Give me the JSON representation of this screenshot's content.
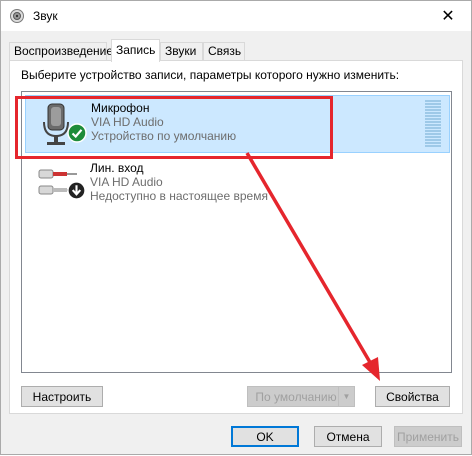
{
  "window": {
    "title": "Звук"
  },
  "tabs": [
    {
      "label": "Воспроизведение",
      "active": false
    },
    {
      "label": "Запись",
      "active": true
    },
    {
      "label": "Звуки",
      "active": false
    },
    {
      "label": "Связь",
      "active": false
    }
  ],
  "panel": {
    "prompt": "Выберите устройство записи, параметры которого нужно изменить:"
  },
  "devices": [
    {
      "name": "Микрофон",
      "driver": "VIA HD Audio",
      "status": "Устройство по умолчанию",
      "selected": true,
      "icon": "microphone-icon",
      "badge": "default-check-icon"
    },
    {
      "name": "Лин. вход",
      "driver": "VIA HD Audio",
      "status": "Недоступно в настоящее время",
      "selected": false,
      "icon": "line-in-jack-icon",
      "badge": "down-arrow-icon"
    }
  ],
  "buttons": {
    "configure": "Настроить",
    "default": "По умолчанию",
    "properties": "Свойства",
    "ok": "OK",
    "cancel": "Отмена",
    "apply": "Применить"
  },
  "colors": {
    "annotation": "#e5262d",
    "selection": "#cce8ff",
    "check_badge": "#1e8c3a"
  }
}
